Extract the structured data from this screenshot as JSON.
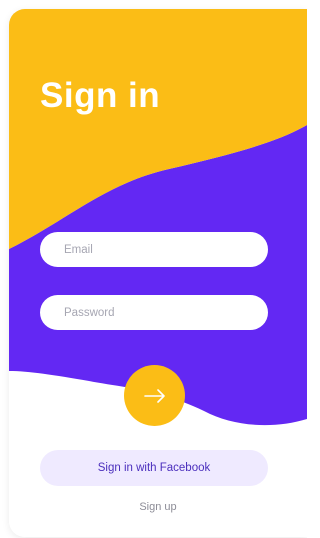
{
  "title": "Sign in",
  "email": {
    "placeholder": "Email"
  },
  "password": {
    "placeholder": "Password"
  },
  "submit": {
    "icon": "arrow-right-icon"
  },
  "facebook_button": {
    "label": "Sign in with Facebook"
  },
  "signup_link": {
    "label": "Sign up"
  },
  "colors": {
    "yellow": "#fbbd16",
    "purple": "#6328f3",
    "facebook_button_bg": "#efeaff",
    "facebook_button_text": "#4b2fbd"
  }
}
